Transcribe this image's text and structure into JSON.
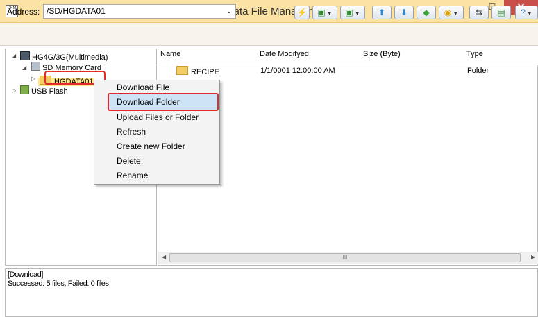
{
  "window": {
    "title": "Data File Manager",
    "app_icon_text": "DFM",
    "minimize": "–",
    "maximize": "☐",
    "close": "✕"
  },
  "address": {
    "label": "Address:",
    "value": "/SD/HGDATA01",
    "dropdown": "⌄"
  },
  "toolbar": {
    "icons": [
      "lightning-icon",
      "copy-icon",
      "paste-icon",
      "upload-icon",
      "download-icon",
      "move-icon",
      "globe-icon",
      "transfer-icon",
      "page-icon",
      "help-icon"
    ]
  },
  "tree": {
    "root": "HG4G/3G(Multimedia)",
    "sd": "SD Memory Card",
    "folder": "HGDATA01",
    "usb": "USB Flash"
  },
  "list": {
    "columns": [
      "Name",
      "Date Modifyed",
      "Size (Byte)",
      "Type"
    ],
    "rows": [
      {
        "name": "RECIPE",
        "date": "1/1/0001 12:00:00 AM",
        "size": "",
        "type": "Folder"
      }
    ],
    "scroll_thumb": "III"
  },
  "context_menu": {
    "items": [
      "Download File",
      "Download Folder",
      "Upload Files or Folder",
      "Refresh",
      "Create new Folder",
      "Delete",
      "Rename"
    ],
    "selected": "Download Folder"
  },
  "log": {
    "lines": [
      "[Download]",
      "Successed: 5 files, Failed: 0 files"
    ]
  },
  "colors": {
    "titlebar": "#fbe3a5",
    "close": "#c9504a",
    "highlight_border": "#e32b2b",
    "menu_selection": "#cde4f7"
  }
}
